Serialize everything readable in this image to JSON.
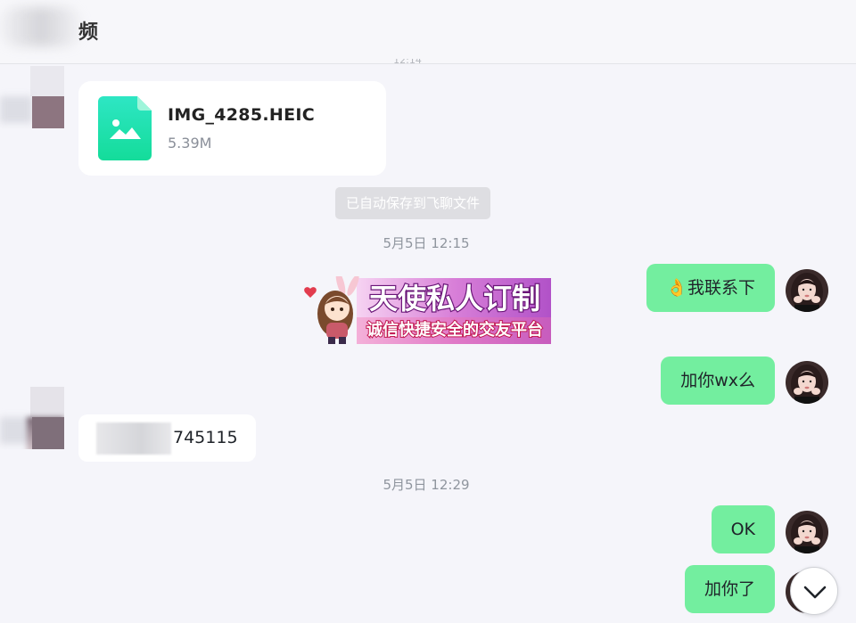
{
  "header": {
    "title": "频"
  },
  "messages": {
    "file": {
      "name": "IMG_4285.HEIC",
      "size": "5.39M"
    },
    "system_note": "已自动保存到飞聊文件",
    "time_1": "5月5日 12:15",
    "out_1": "👌我联系下",
    "sticker": {
      "title": "天使私人订制",
      "subtitle": "诚信快捷安全的交友平台"
    },
    "out_2": "加你wx么",
    "in_1": "745115",
    "time_2": "5月5日 12:29",
    "out_3": "OK",
    "out_4": "加你了"
  },
  "colors": {
    "outgoing_bubble": "#73ee9f",
    "incoming_bubble": "#ffffff",
    "background": "#f5f5fa",
    "file_icon": "#20e3b2"
  },
  "icons": {
    "file": "image-file-icon",
    "scroll": "chevron-down-icon"
  }
}
